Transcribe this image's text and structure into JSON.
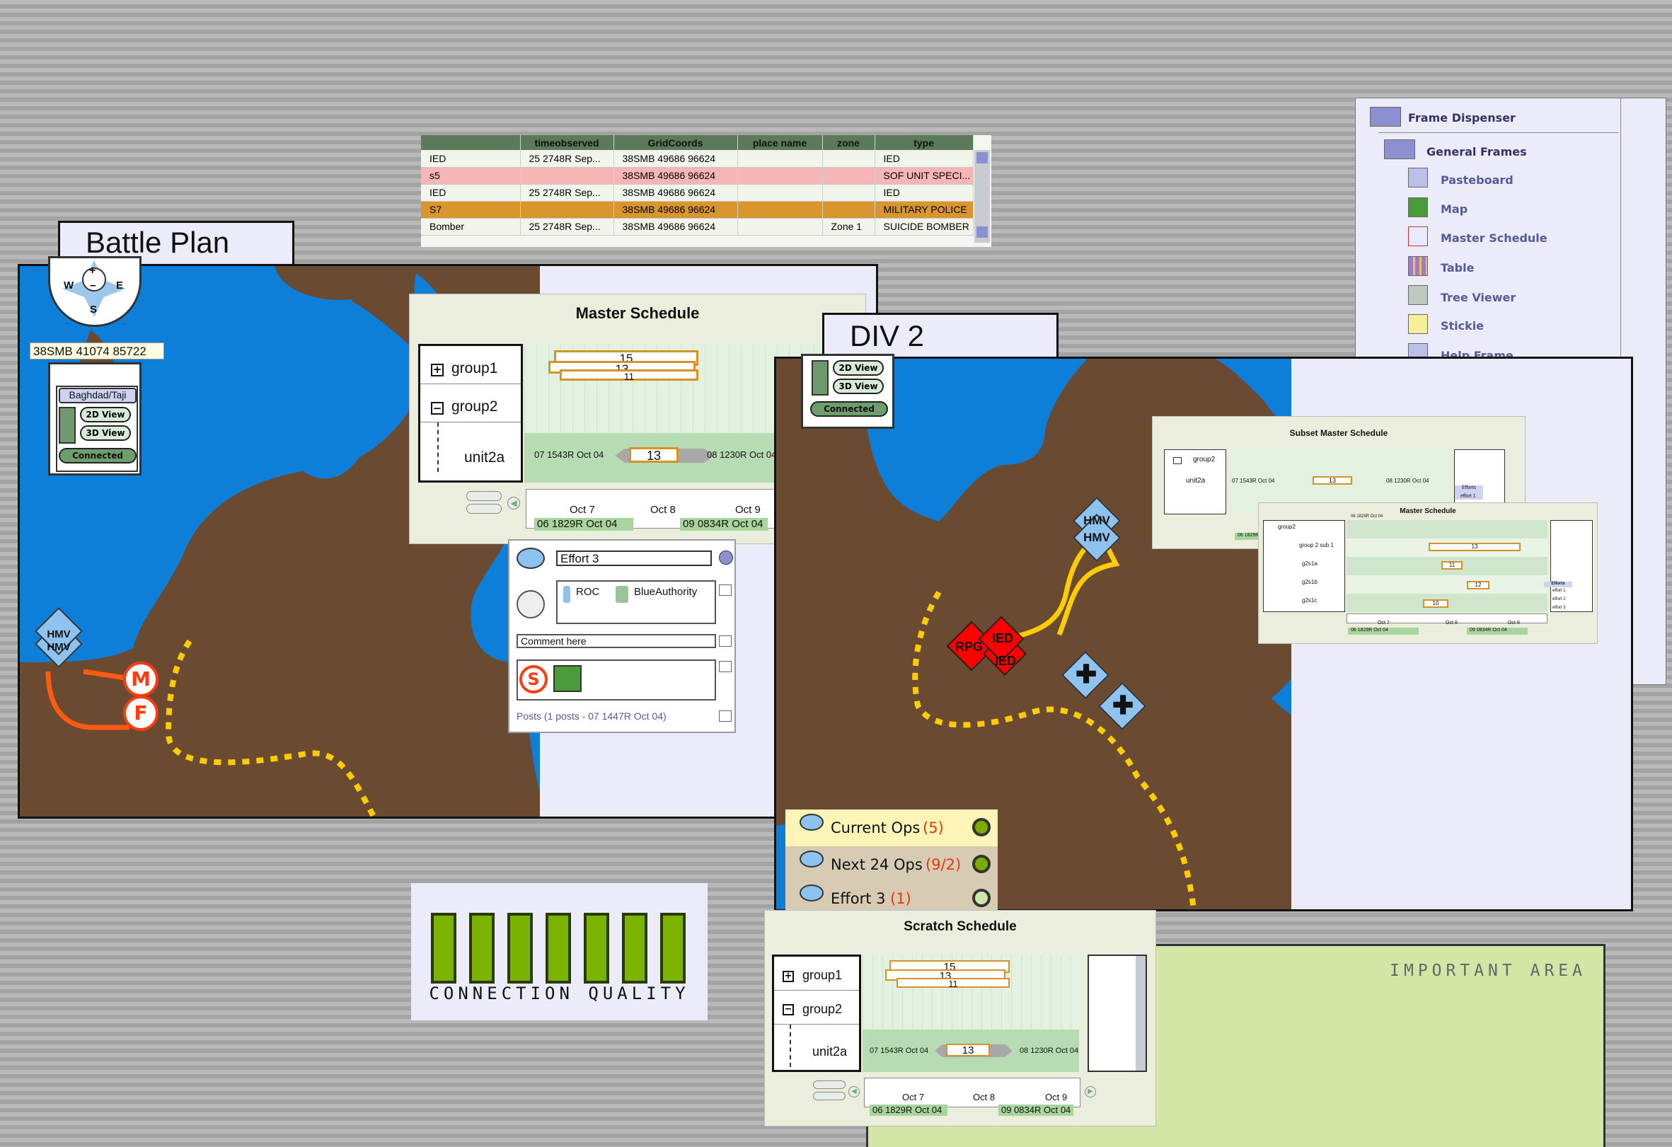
{
  "table": {
    "columns": [
      "",
      "timeobserved",
      "GridCoords",
      "place name",
      "zone",
      "type"
    ],
    "rows": [
      {
        "name": "IED",
        "time": "25 2748R Sep...",
        "grid": "38SMB 49686 96624",
        "place": "",
        "zone": "",
        "type": "IED"
      },
      {
        "name": "s5",
        "time": "",
        "grid": "38SMB 49686 96624",
        "place": "",
        "zone": "",
        "type": "SOF UNIT SPECI..."
      },
      {
        "name": "IED",
        "time": "25 2748R Sep...",
        "grid": "38SMB 49686 96624",
        "place": "",
        "zone": "",
        "type": "IED"
      },
      {
        "name": "S7",
        "time": "",
        "grid": "38SMB 49686 96624",
        "place": "",
        "zone": "",
        "type": "MILITARY POLICE"
      },
      {
        "name": "Bomber",
        "time": "25 2748R Sep...",
        "grid": "38SMB 49686 96624",
        "place": "",
        "zone": "Zone 1",
        "type": "SUICIDE BOMBER"
      }
    ]
  },
  "battle_plan": {
    "title": "Battle Plan",
    "coords": "38SMB  41074  85722",
    "location": "Baghdad/Taji",
    "view2d": "2D View",
    "view3d": "3D View",
    "connected": "Connected",
    "compass": {
      "w": "W",
      "e": "E",
      "s": "S",
      "plus": "+",
      "minus": "–"
    },
    "units": [
      "HMV",
      "HMV"
    ],
    "markers": [
      "M",
      "F"
    ]
  },
  "master_schedule": {
    "title": "Master Schedule",
    "groups": [
      "group1",
      "group2",
      "unit2a"
    ],
    "bars": [
      "15",
      "13",
      "11"
    ],
    "selected_bar": "13",
    "range_start": "07 1543R Oct 04",
    "range_end": "08 1230R Oct 04",
    "days": [
      "Oct 7",
      "Oct 8",
      "Oct 9"
    ],
    "start": "06 1829R Oct 04",
    "end": "09 0834R Oct 04"
  },
  "effort": {
    "name": "Effort 3",
    "roc": "ROC",
    "authority": "BlueAuthority",
    "comment": "Comment here",
    "posts": "Posts (1 posts - 07 1447R Oct 04)"
  },
  "div2": {
    "title": "DIV 2",
    "view2d": "2D View",
    "view3d": "3D View",
    "connected": "Connected",
    "units": [
      "HMV",
      "HMV"
    ],
    "threats": [
      "RPG",
      "IED",
      "IED"
    ]
  },
  "ops": [
    {
      "label": "Current Ops",
      "count": "(5)",
      "color": "#7aad00"
    },
    {
      "label": "Next 24 Ops",
      "count": "(9/2)",
      "color": "#7aad00"
    },
    {
      "label": "Effort 3",
      "count": "(1)",
      "color": "#cfe6a6"
    }
  ],
  "subset_schedule": {
    "title": "Subset Master Schedule",
    "group": "group2",
    "unit": "unit2a",
    "range_start": "07 1543R Oct 04",
    "bar": "13",
    "range_end": "08 1230R Oct 04",
    "start": "06 1829R Oct 04",
    "efforts_title": "Efforts",
    "efforts": [
      "effort 1"
    ]
  },
  "inner_master_schedule": {
    "title": "Master Schedule",
    "groups": [
      "group2",
      "group 2 sub 1",
      "g2s1a",
      "g2s1b",
      "g2s1c"
    ],
    "bars": [
      "13",
      "11",
      "12",
      "10"
    ],
    "topdate": "06 1829R Oct 04",
    "days": [
      "Oct 7",
      "Oct 8",
      "Oct 9"
    ],
    "start": "06 1829R Oct 04",
    "end": "09 0834R Oct 04",
    "efforts_title": "Efforts",
    "efforts": [
      "effort 1",
      "effort 2",
      "effort 3"
    ]
  },
  "frame_dispenser": {
    "title": "Frame Dispenser",
    "section": "General Frames",
    "items": [
      {
        "label": "Pasteboard",
        "icon": "pasteboard-icon"
      },
      {
        "label": "Map",
        "icon": "map-icon"
      },
      {
        "label": "Master Schedule",
        "icon": "master-schedule-icon"
      },
      {
        "label": "Table",
        "icon": "table-icon"
      },
      {
        "label": "Tree Viewer",
        "icon": "tree-viewer-icon"
      },
      {
        "label": "Stickie",
        "icon": "stickie-icon"
      },
      {
        "label": "Help Frame",
        "icon": "help-frame-icon"
      }
    ]
  },
  "connection_quality": {
    "label": "CONNECTION QUALITY",
    "level": 7,
    "max": 7
  },
  "scratch_schedule": {
    "title": "Scratch Schedule",
    "groups": [
      "group1",
      "group2",
      "unit2a"
    ],
    "bars": [
      "15",
      "13",
      "11"
    ],
    "selected_bar": "13",
    "range_start": "07 1543R Oct 04",
    "range_end": "08 1230R Oct 04",
    "days": [
      "Oct 7",
      "Oct 8",
      "Oct 9"
    ],
    "start": "06 1829R Oct 04",
    "end": "09 0834R Oct 04"
  },
  "important_area": {
    "label": "IMPORTANT AREA"
  },
  "colors": {
    "water": "#0e7fd8",
    "land": "#6b4a32",
    "route": "#ffcc00",
    "hostile": "#ff0000",
    "friendly": "#8ec3f0"
  }
}
